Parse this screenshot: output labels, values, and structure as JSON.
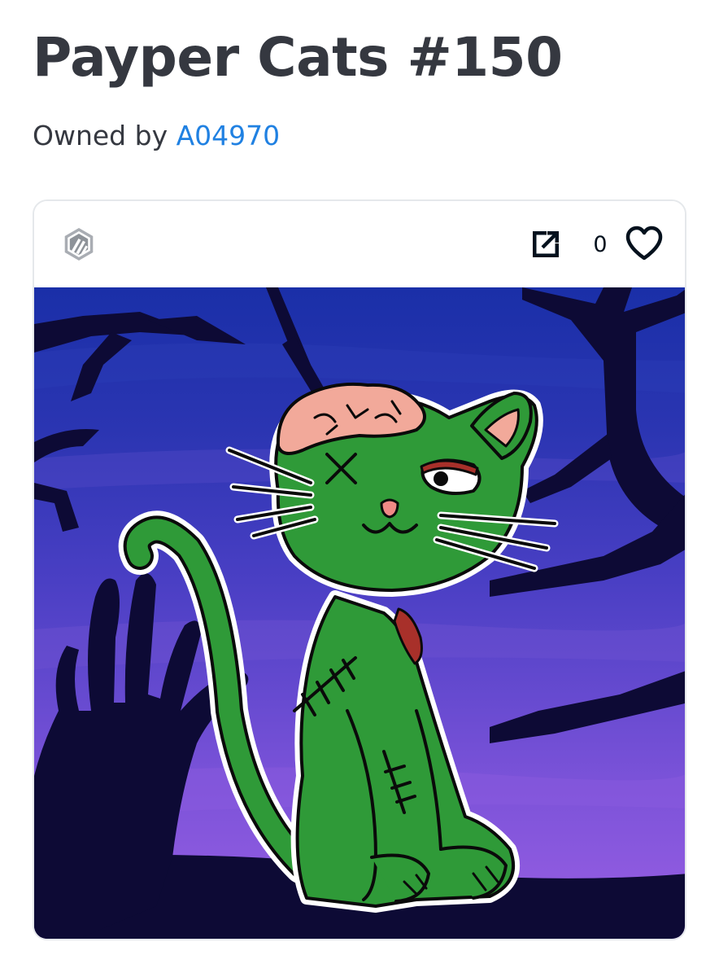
{
  "asset": {
    "title": "Payper Cats #150",
    "owned_by_label": "Owned by",
    "owner_name": "A04970"
  },
  "card": {
    "chain_icon": "arbitrum-logo-icon",
    "external_link_icon": "external-link-icon",
    "favorite_icon": "heart-outline-icon",
    "favorite_count": "0"
  },
  "artwork": {
    "subject": "green zombie cat with exposed brain, stitches and wound",
    "background": "night sky with dead tree branches and a silhouette hand",
    "colors": {
      "sky_top": "#1a2fa8",
      "sky_bottom": "#8b55e0",
      "silhouette": "#0d0a35",
      "cat_body": "#2f9a38",
      "cat_outline": "#0a0a0a",
      "brain": "#f2a99a",
      "nose": "#f08a86",
      "wound": "#a8302a"
    }
  },
  "colors": {
    "title_text": "#353840",
    "owner_link": "#2081e2",
    "card_border": "#e5e8eb"
  }
}
